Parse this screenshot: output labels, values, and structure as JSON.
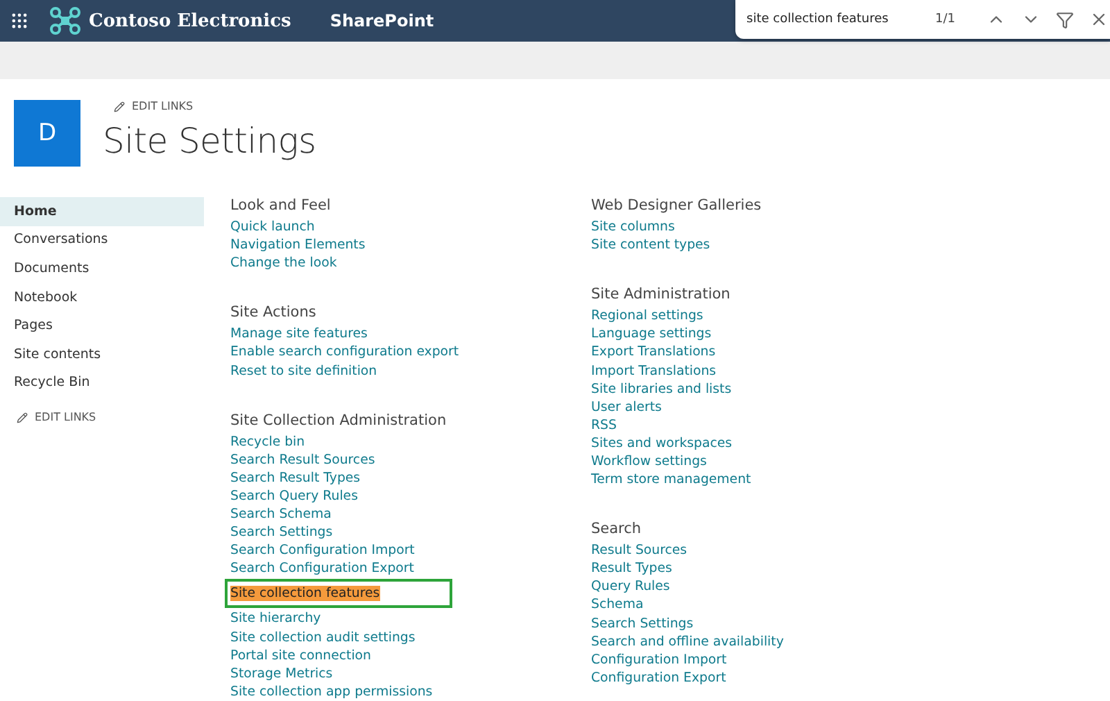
{
  "suite_bar": {
    "app_name": "Contoso Electronics",
    "product": "SharePoint"
  },
  "find_bar": {
    "value": "site collection features",
    "count": "1/1"
  },
  "header": {
    "edit_links": "EDIT LINKS",
    "site_initial": "D",
    "title": "Site Settings"
  },
  "sidebar": {
    "items": [
      {
        "label": "Home",
        "selected": true
      },
      {
        "label": "Conversations",
        "selected": false
      },
      {
        "label": "Documents",
        "selected": false
      },
      {
        "label": "Notebook",
        "selected": false
      },
      {
        "label": "Pages",
        "selected": false
      },
      {
        "label": "Site contents",
        "selected": false
      },
      {
        "label": "Recycle Bin",
        "selected": false
      }
    ],
    "edit_links": "EDIT LINKS"
  },
  "columns": [
    [
      {
        "heading": "Look and Feel",
        "links": [
          {
            "label": "Quick launch",
            "match": false
          },
          {
            "label": "Navigation Elements",
            "match": false
          },
          {
            "label": "Change the look",
            "match": false
          }
        ]
      },
      {
        "heading": "Site Actions",
        "links": [
          {
            "label": "Manage site features",
            "match": false
          },
          {
            "label": "Enable search configuration export",
            "match": false
          },
          {
            "label": "Reset to site definition",
            "match": false
          }
        ]
      },
      {
        "heading": "Site Collection Administration",
        "links": [
          {
            "label": "Recycle bin",
            "match": false
          },
          {
            "label": "Search Result Sources",
            "match": false
          },
          {
            "label": "Search Result Types",
            "match": false
          },
          {
            "label": "Search Query Rules",
            "match": false
          },
          {
            "label": "Search Schema",
            "match": false
          },
          {
            "label": "Search Settings",
            "match": false
          },
          {
            "label": "Search Configuration Import",
            "match": false
          },
          {
            "label": "Search Configuration Export",
            "match": false
          },
          {
            "label": "Site collection features",
            "match": true
          },
          {
            "label": "Site hierarchy",
            "match": false
          },
          {
            "label": "Site collection audit settings",
            "match": false
          },
          {
            "label": "Portal site connection",
            "match": false
          },
          {
            "label": "Storage Metrics",
            "match": false
          },
          {
            "label": "Site collection app permissions",
            "match": false
          }
        ]
      }
    ],
    [
      {
        "heading": "Web Designer Galleries",
        "links": [
          {
            "label": "Site columns",
            "match": false
          },
          {
            "label": "Site content types",
            "match": false
          }
        ]
      },
      {
        "heading": "Site Administration",
        "links": [
          {
            "label": "Regional settings",
            "match": false
          },
          {
            "label": "Language settings",
            "match": false
          },
          {
            "label": "Export Translations",
            "match": false
          },
          {
            "label": "Import Translations",
            "match": false
          },
          {
            "label": "Site libraries and lists",
            "match": false
          },
          {
            "label": "User alerts",
            "match": false
          },
          {
            "label": "RSS",
            "match": false
          },
          {
            "label": "Sites and workspaces",
            "match": false
          },
          {
            "label": "Workflow settings",
            "match": false
          },
          {
            "label": "Term store management",
            "match": false
          }
        ]
      },
      {
        "heading": "Search",
        "links": [
          {
            "label": "Result Sources",
            "match": false
          },
          {
            "label": "Result Types",
            "match": false
          },
          {
            "label": "Query Rules",
            "match": false
          },
          {
            "label": "Schema",
            "match": false
          },
          {
            "label": "Search Settings",
            "match": false
          },
          {
            "label": "Search and offline availability",
            "match": false
          },
          {
            "label": "Configuration Import",
            "match": false
          },
          {
            "label": "Configuration Export",
            "match": false
          }
        ]
      }
    ]
  ]
}
